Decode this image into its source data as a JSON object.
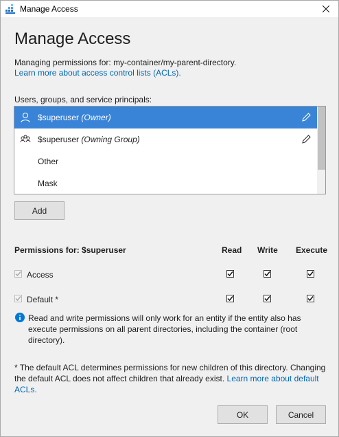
{
  "window": {
    "title": "Manage Access"
  },
  "page": {
    "heading": "Manage Access",
    "managing_text": "Managing permissions for: my-container/my-parent-directory.",
    "learn_link": "Learn more about access control lists (ACLs).",
    "users_label": "Users, groups, and service principals:"
  },
  "principals": [
    {
      "name": "$superuser",
      "role": "(Owner)",
      "icon": "user-icon",
      "selected": true
    },
    {
      "name": "$superuser",
      "role": "(Owning Group)",
      "icon": "group-icon",
      "selected": false
    },
    {
      "name": "Other"
    },
    {
      "name": "Mask"
    }
  ],
  "buttons": {
    "add": "Add",
    "ok": "OK",
    "cancel": "Cancel"
  },
  "permissions": {
    "title": "Permissions for: $superuser",
    "columns": [
      "Read",
      "Write",
      "Execute"
    ],
    "rows": [
      {
        "label": "Access",
        "enabled": true,
        "read": true,
        "write": true,
        "execute": true
      },
      {
        "label": "Default *",
        "enabled": true,
        "read": true,
        "write": true,
        "execute": true
      }
    ]
  },
  "info_text": "Read and write permissions will only work for an entity if the entity also has execute permissions on all parent directories, including the container (root directory).",
  "footnote": {
    "text": "* The default ACL determines permissions for new children of this directory. Changing the default ACL does not affect children that already exist. ",
    "link": "Learn more about default ACLs."
  },
  "colors": {
    "selection": "#3a84d8",
    "link": "#0066b4",
    "info": "#0078d4"
  }
}
